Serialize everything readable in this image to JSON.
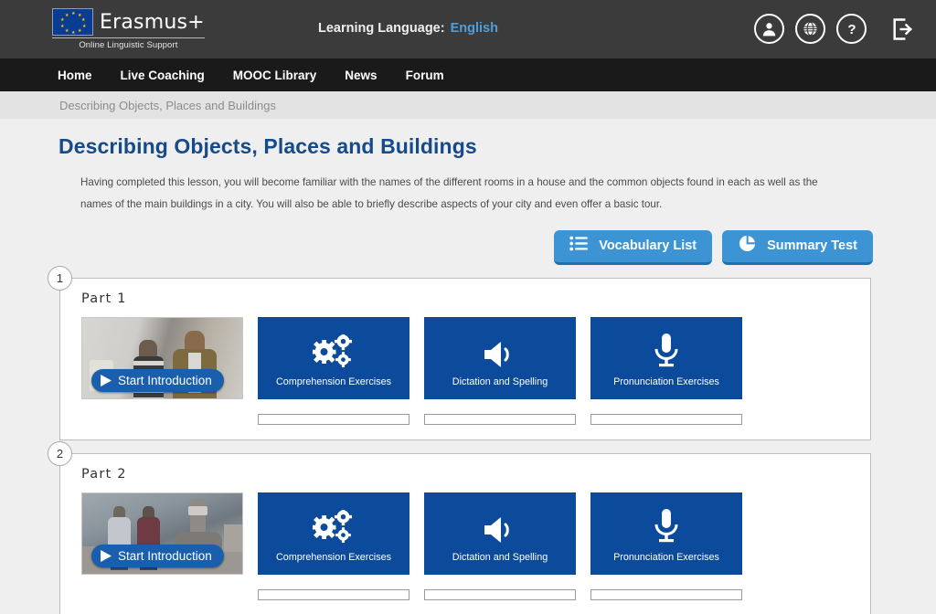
{
  "header": {
    "brand_name": "Erasmus+",
    "brand_subtitle": "Online Linguistic Support",
    "learning_language_label": "Learning Language:",
    "learning_language_value": "English",
    "icons": [
      {
        "name": "account-icon",
        "title": "Account"
      },
      {
        "name": "globe-icon",
        "title": "Language"
      },
      {
        "name": "help-icon",
        "title": "Help"
      },
      {
        "name": "logout-icon",
        "title": "Log out"
      }
    ]
  },
  "nav": {
    "items": [
      {
        "label": "Home"
      },
      {
        "label": "Live Coaching"
      },
      {
        "label": "MOOC Library"
      },
      {
        "label": "News"
      },
      {
        "label": "Forum"
      }
    ]
  },
  "breadcrumb": {
    "text": "Describing Objects, Places and Buildings"
  },
  "lesson": {
    "title": "Describing Objects, Places and Buildings",
    "description": "Having completed this lesson, you will become familiar with the names of the different rooms in a house and the common objects found in each as well as the names of the main buildings in a city. You will also be able to briefly describe aspects of your city and even offer a basic tour."
  },
  "actions": [
    {
      "label": "Vocabulary List",
      "icon": "list-icon"
    },
    {
      "label": "Summary Test",
      "icon": "pie-chart-icon"
    }
  ],
  "parts": [
    {
      "badge": "1",
      "heading": "Part 1",
      "video": {
        "play_label": "Start Introduction",
        "scene": "two-men-talking-indoors"
      },
      "exercises": [
        {
          "label": "Comprehension Exercises",
          "icon": "gears-icon",
          "progress": 0
        },
        {
          "label": "Dictation and Spelling",
          "icon": "speaker-icon",
          "progress": 0
        },
        {
          "label": "Pronunciation Exercises",
          "icon": "microphone-icon",
          "progress": 0
        }
      ]
    },
    {
      "badge": "2",
      "heading": "Part 2",
      "video": {
        "play_label": "Start Introduction",
        "scene": "street-with-clock-tower"
      },
      "exercises": [
        {
          "label": "Comprehension Exercises",
          "icon": "gears-icon",
          "progress": 0
        },
        {
          "label": "Dictation and Spelling",
          "icon": "speaker-icon",
          "progress": 0
        },
        {
          "label": "Pronunciation Exercises",
          "icon": "microphone-icon",
          "progress": 0
        }
      ]
    }
  ],
  "colors": {
    "header_bg": "#3b3b3b",
    "nav_bg": "#1a1a1a",
    "page_bg": "#efefef",
    "title_blue": "#164a8a",
    "tile_blue": "#0c4b9c",
    "button_blue": "#3d94d4",
    "link_blue": "#4b9fe0"
  }
}
